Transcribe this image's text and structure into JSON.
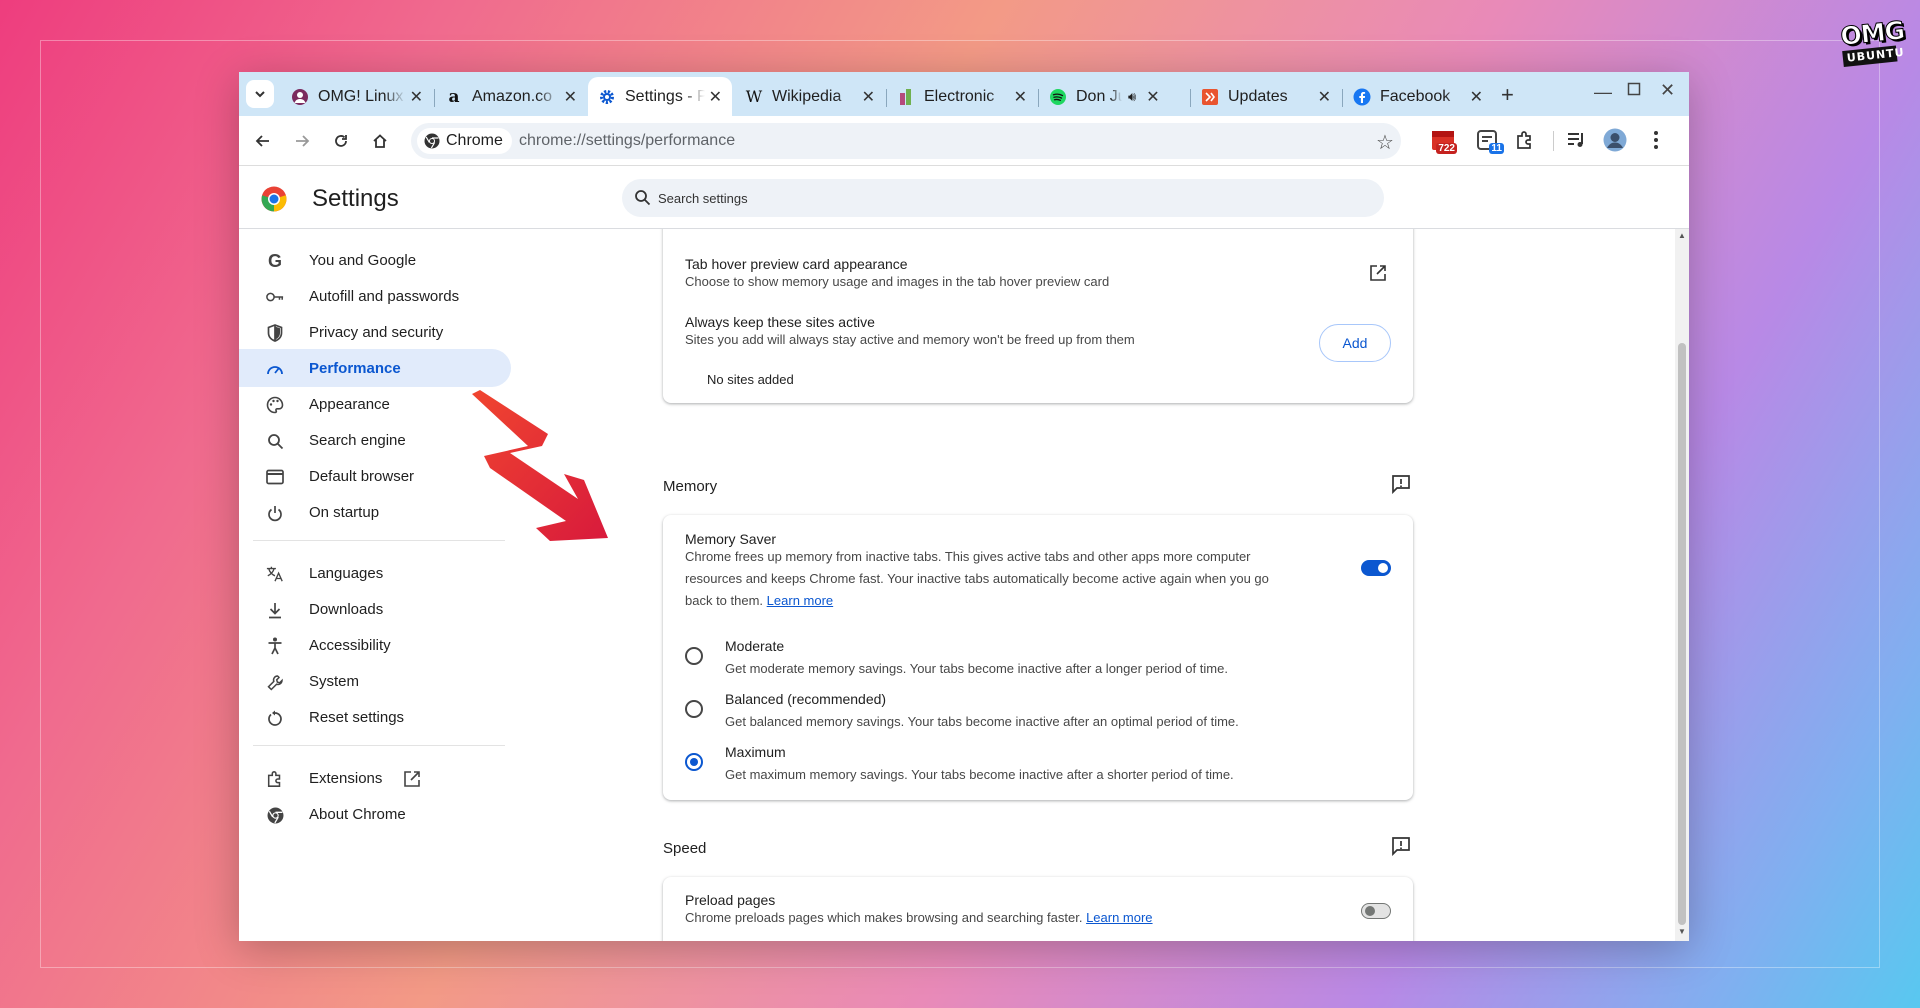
{
  "watermark": {
    "line1": "OMG",
    "line2": "UBUNTU"
  },
  "tabs": [
    {
      "title": "OMG! Linux"
    },
    {
      "title": "Amazon.co"
    },
    {
      "title": "Settings - Performance"
    },
    {
      "title": "Wikipedia"
    },
    {
      "title": "Electronic"
    },
    {
      "title": "Don Juan"
    },
    {
      "title": "Updates"
    },
    {
      "title": "Facebook"
    }
  ],
  "toolbar": {
    "chip_label": "Chrome",
    "url": "chrome://settings/performance",
    "ext_badge_1": "722",
    "ext_badge_2": "11"
  },
  "header": {
    "title": "Settings",
    "search_placeholder": "Search settings"
  },
  "sidebar": {
    "items": [
      {
        "label": "You and Google"
      },
      {
        "label": "Autofill and passwords"
      },
      {
        "label": "Privacy and security"
      },
      {
        "label": "Performance"
      },
      {
        "label": "Appearance"
      },
      {
        "label": "Search engine"
      },
      {
        "label": "Default browser"
      },
      {
        "label": "On startup"
      },
      {
        "label": "Languages"
      },
      {
        "label": "Downloads"
      },
      {
        "label": "Accessibility"
      },
      {
        "label": "System"
      },
      {
        "label": "Reset settings"
      },
      {
        "label": "Extensions"
      },
      {
        "label": "About Chrome"
      }
    ]
  },
  "tabs_card": {
    "hover_title": "Tab hover preview card appearance",
    "hover_sub": "Choose to show memory usage and images in the tab hover preview card",
    "active_title": "Always keep these sites active",
    "active_sub": "Sites you add will always stay active and memory won't be freed up from them",
    "add_label": "Add",
    "empty": "No sites added"
  },
  "memory": {
    "heading": "Memory",
    "saver_title": "Memory Saver",
    "saver_line1": "Chrome frees up memory from inactive tabs. This gives active tabs and other apps more computer",
    "saver_line2": "resources and keeps Chrome fast. Your inactive tabs automatically become active again when you go",
    "saver_line3": "back to them.",
    "learn_more": "Learn more",
    "saver_enabled": true,
    "options": [
      {
        "label": "Moderate",
        "desc": "Get moderate memory savings. Your tabs become inactive after a longer period of time."
      },
      {
        "label": "Balanced (recommended)",
        "desc": "Get balanced memory savings. Your tabs become inactive after an optimal period of time."
      },
      {
        "label": "Maximum",
        "desc": "Get maximum memory savings. Your tabs become inactive after a shorter period of time."
      }
    ],
    "selected": "Maximum"
  },
  "speed": {
    "heading": "Speed",
    "preload_title": "Preload pages",
    "preload_sub": "Chrome preloads pages which makes browsing and searching faster.",
    "learn_more": "Learn more",
    "preload_enabled": false
  },
  "colors": {
    "accent": "#0b57d0",
    "tabstrip": "#cfe6f7",
    "nav_active_bg": "#e1ebfb",
    "arrow": "#e8283a"
  }
}
